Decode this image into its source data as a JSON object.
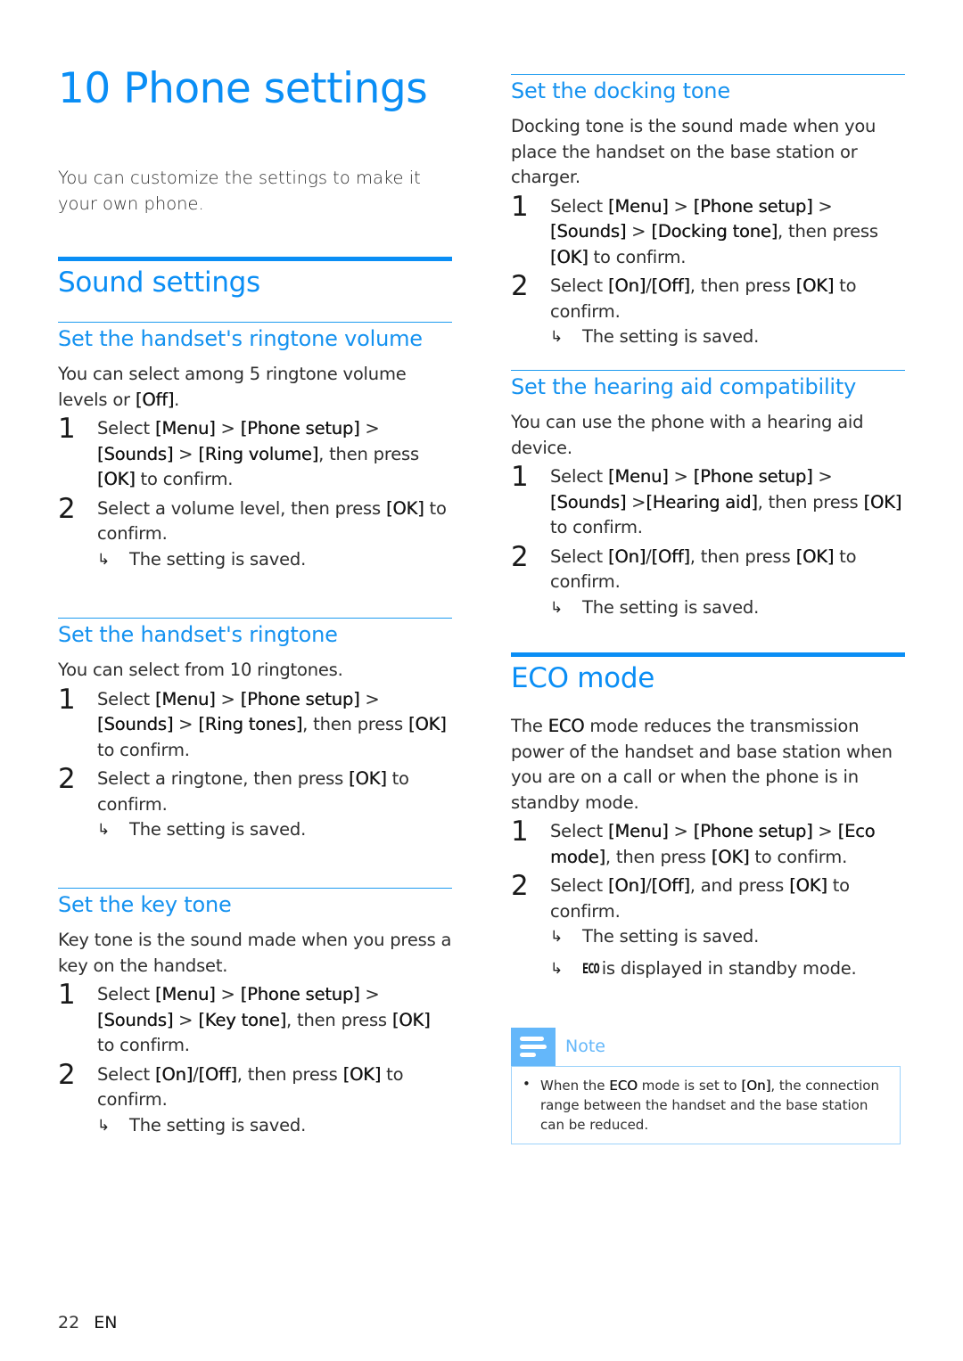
{
  "page": {
    "chapter_title": "10 Phone settings",
    "intro": "You can customize the settings to make it your own phone.",
    "footer": {
      "page_number": "22",
      "language": "EN"
    }
  },
  "theme": {
    "accent": "#0a8ef5",
    "note_accent": "#64b7fa",
    "note_border": "#9dd3fb"
  },
  "sound_settings": {
    "title": "Sound settings",
    "ringtone_volume": {
      "title": "Set the handset's ringtone volume",
      "description": [
        {
          "t": "You can select among 5 ringtone volume levels or "
        },
        {
          "t": "[Off]",
          "b": true
        },
        {
          "t": "."
        }
      ],
      "steps": [
        {
          "num": "1",
          "text": [
            {
              "t": "Select "
            },
            {
              "t": "[Menu]",
              "b": true
            },
            {
              "t": " > "
            },
            {
              "t": "[Phone setup]",
              "b": true
            },
            {
              "t": " > "
            },
            {
              "t": "[Sounds]",
              "b": true
            },
            {
              "t": " > "
            },
            {
              "t": "[Ring volume]",
              "b": true
            },
            {
              "t": ", then press "
            },
            {
              "t": "[OK]",
              "b": true
            },
            {
              "t": " to confirm."
            }
          ]
        },
        {
          "num": "2",
          "text": [
            {
              "t": "Select a volume level, then press "
            },
            {
              "t": "[OK]",
              "b": true
            },
            {
              "t": " to confirm."
            }
          ],
          "results": [
            "The setting is saved."
          ]
        }
      ]
    },
    "ringtone": {
      "title": "Set the handset's ringtone",
      "description": [
        {
          "t": "You can select from 10 ringtones."
        }
      ],
      "steps": [
        {
          "num": "1",
          "text": [
            {
              "t": "Select "
            },
            {
              "t": "[Menu]",
              "b": true
            },
            {
              "t": " > "
            },
            {
              "t": "[Phone setup]",
              "b": true
            },
            {
              "t": " > "
            },
            {
              "t": "[Sounds]",
              "b": true
            },
            {
              "t": " > "
            },
            {
              "t": "[Ring tones]",
              "b": true
            },
            {
              "t": ", then press "
            },
            {
              "t": "[OK]",
              "b": true
            },
            {
              "t": " to confirm."
            }
          ]
        },
        {
          "num": "2",
          "text": [
            {
              "t": "Select a ringtone, then press "
            },
            {
              "t": "[OK]",
              "b": true
            },
            {
              "t": " to confirm."
            }
          ],
          "results": [
            "The setting is saved."
          ]
        }
      ]
    },
    "key_tone": {
      "title": "Set the key tone",
      "description": [
        {
          "t": "Key tone is the sound made when you press a key on the handset."
        }
      ],
      "steps": [
        {
          "num": "1",
          "text": [
            {
              "t": "Select "
            },
            {
              "t": "[Menu]",
              "b": true
            },
            {
              "t": " > "
            },
            {
              "t": "[Phone setup]",
              "b": true
            },
            {
              "t": " > "
            },
            {
              "t": "[Sounds]",
              "b": true
            },
            {
              "t": " > "
            },
            {
              "t": "[Key tone]",
              "b": true
            },
            {
              "t": ", then press "
            },
            {
              "t": "[OK]",
              "b": true
            },
            {
              "t": " to confirm."
            }
          ]
        },
        {
          "num": "2",
          "text": [
            {
              "t": "Select "
            },
            {
              "t": "[On]",
              "b": true
            },
            {
              "t": "/"
            },
            {
              "t": "[Off]",
              "b": true
            },
            {
              "t": ", then press "
            },
            {
              "t": "[OK]",
              "b": true
            },
            {
              "t": " to confirm."
            }
          ],
          "results": [
            "The setting is saved."
          ]
        }
      ]
    },
    "docking_tone": {
      "title": "Set the docking tone",
      "description": [
        {
          "t": "Docking tone is the sound made when you place the handset on the base station or charger."
        }
      ],
      "steps": [
        {
          "num": "1",
          "text": [
            {
              "t": "Select "
            },
            {
              "t": "[Menu]",
              "b": true
            },
            {
              "t": " > "
            },
            {
              "t": "[Phone setup]",
              "b": true
            },
            {
              "t": " > "
            },
            {
              "t": "[Sounds]",
              "b": true
            },
            {
              "t": " > "
            },
            {
              "t": "[Docking tone]",
              "b": true
            },
            {
              "t": ", then press "
            },
            {
              "t": "[OK]",
              "b": true
            },
            {
              "t": " to confirm."
            }
          ]
        },
        {
          "num": "2",
          "text": [
            {
              "t": "Select "
            },
            {
              "t": "[On]",
              "b": true
            },
            {
              "t": "/"
            },
            {
              "t": "[Off]",
              "b": true
            },
            {
              "t": ", then press "
            },
            {
              "t": "[OK]",
              "b": true
            },
            {
              "t": " to confirm."
            }
          ],
          "results": [
            "The setting is saved."
          ]
        }
      ]
    },
    "hearing_aid": {
      "title": "Set the hearing aid compatibility",
      "description": [
        {
          "t": "You can use the phone with a hearing aid device."
        }
      ],
      "steps": [
        {
          "num": "1",
          "text": [
            {
              "t": "Select "
            },
            {
              "t": "[Menu]",
              "b": true
            },
            {
              "t": " > "
            },
            {
              "t": "[Phone setup]",
              "b": true
            },
            {
              "t": " > "
            },
            {
              "t": "[Sounds]",
              "b": true
            },
            {
              "t": " >"
            },
            {
              "t": "[Hearing aid]",
              "b": true
            },
            {
              "t": ", then press "
            },
            {
              "t": "[OK]",
              "b": true
            },
            {
              "t": " to confirm."
            }
          ]
        },
        {
          "num": "2",
          "text": [
            {
              "t": "Select "
            },
            {
              "t": "[On]",
              "b": true
            },
            {
              "t": "/"
            },
            {
              "t": "[Off]",
              "b": true
            },
            {
              "t": ", then press "
            },
            {
              "t": "[OK]",
              "b": true
            },
            {
              "t": " to confirm."
            }
          ],
          "results": [
            "The setting is saved."
          ]
        }
      ]
    }
  },
  "eco_mode": {
    "title": "ECO mode",
    "description": [
      {
        "t": "The "
      },
      {
        "t": "ECO",
        "b": true
      },
      {
        "t": " mode reduces the transmission power of the handset and base station when you are on a call or when the phone is in standby mode."
      }
    ],
    "steps": [
      {
        "num": "1",
        "text": [
          {
            "t": "Select "
          },
          {
            "t": "[Menu]",
            "b": true
          },
          {
            "t": " > "
          },
          {
            "t": "[Phone setup]",
            "b": true
          },
          {
            "t": " > "
          },
          {
            "t": "[Eco mode]",
            "b": true
          },
          {
            "t": ", then press "
          },
          {
            "t": "[OK]",
            "b": true
          },
          {
            "t": " to confirm."
          }
        ]
      },
      {
        "num": "2",
        "text": [
          {
            "t": "Select "
          },
          {
            "t": "[On]",
            "b": true
          },
          {
            "t": "/"
          },
          {
            "t": "[Off]",
            "b": true
          },
          {
            "t": ", and press "
          },
          {
            "t": "[OK]",
            "b": true
          },
          {
            "t": " to confirm."
          }
        ],
        "results": [
          "The setting is saved."
        ],
        "eco_result": {
          "icon_text": "ECO",
          "text": "is displayed in standby mode."
        }
      }
    ],
    "note": {
      "label": "Note",
      "items": [
        [
          {
            "t": "When the "
          },
          {
            "t": "ECO",
            "b": true
          },
          {
            "t": " mode is set to "
          },
          {
            "t": "[On]",
            "b": true
          },
          {
            "t": ", the connection range between the handset and the base station can be reduced."
          }
        ]
      ]
    }
  },
  "icons": {
    "result_arrow": "↳",
    "bullet": "•",
    "note_icon": "note-lines-icon"
  }
}
